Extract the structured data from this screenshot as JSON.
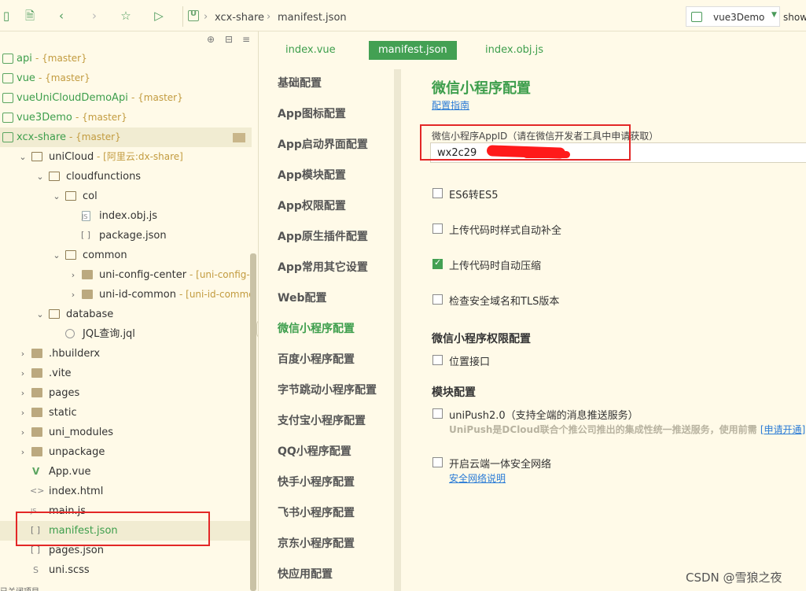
{
  "toolbar": {
    "breadcrumb": [
      "xcx-share",
      "manifest.json"
    ],
    "run_target": "vue3Demo",
    "show_label": "show"
  },
  "tree": {
    "rows": [
      {
        "name": "api",
        "branch": "- {master}",
        "kind": "project"
      },
      {
        "name": "vue",
        "branch": "- {master}",
        "kind": "project"
      },
      {
        "name": "vueUniCloudDemoApi",
        "branch": "- {master}",
        "kind": "project"
      },
      {
        "name": "vue3Demo",
        "branch": "- {master}",
        "kind": "project"
      },
      {
        "name": "xcx-share",
        "branch": "- {master}",
        "kind": "project"
      },
      {
        "name": "uniCloud",
        "branch": "- [阿里云:dx-share]",
        "kind": "folder"
      },
      {
        "name": "cloudfunctions",
        "branch": "",
        "kind": "folder"
      },
      {
        "name": "col",
        "branch": "",
        "kind": "folder"
      },
      {
        "name": "index.obj.js",
        "branch": "",
        "kind": "file"
      },
      {
        "name": "package.json",
        "branch": "",
        "kind": "file"
      },
      {
        "name": "common",
        "branch": "",
        "kind": "folder"
      },
      {
        "name": "uni-config-center",
        "branch": "- [uni-config-center",
        "kind": "folder"
      },
      {
        "name": "uni-id-common",
        "branch": "- [uni-id-common:un",
        "kind": "folder"
      },
      {
        "name": "database",
        "branch": "",
        "kind": "folder"
      },
      {
        "name": "JQL查询.jql",
        "branch": "",
        "kind": "file"
      },
      {
        "name": ".hbuilderx",
        "branch": "",
        "kind": "folder"
      },
      {
        "name": ".vite",
        "branch": "",
        "kind": "folder"
      },
      {
        "name": "pages",
        "branch": "",
        "kind": "folder"
      },
      {
        "name": "static",
        "branch": "",
        "kind": "folder"
      },
      {
        "name": "uni_modules",
        "branch": "",
        "kind": "folder"
      },
      {
        "name": "unpackage",
        "branch": "",
        "kind": "folder"
      },
      {
        "name": "App.vue",
        "branch": "",
        "kind": "file"
      },
      {
        "name": "index.html",
        "branch": "",
        "kind": "file"
      },
      {
        "name": "main.js",
        "branch": "",
        "kind": "file"
      },
      {
        "name": "manifest.json",
        "branch": "",
        "kind": "file"
      },
      {
        "name": "pages.json",
        "branch": "",
        "kind": "file"
      },
      {
        "name": "uni.scss",
        "branch": "",
        "kind": "file"
      }
    ],
    "status_fragment": "已关闭项目"
  },
  "tabs": [
    "index.vue",
    "manifest.json",
    "index.obj.js"
  ],
  "nav": [
    "基础配置",
    "App图标配置",
    "App启动界面配置",
    "App模块配置",
    "App权限配置",
    "App原生插件配置",
    "App常用其它设置",
    "Web配置",
    "微信小程序配置",
    "百度小程序配置",
    "字节跳动小程序配置",
    "支付宝小程序配置",
    "QQ小程序配置",
    "快手小程序配置",
    "飞书小程序配置",
    "京东小程序配置",
    "快应用配置"
  ],
  "panel": {
    "title": "微信小程序配置",
    "guide_link": "配置指南",
    "appid_label": "微信小程序AppID（请在微信开发者工具中申请获取）",
    "appid_value": "wx2c29",
    "options": [
      {
        "label": "ES6转ES5",
        "checked": false
      },
      {
        "label": "上传代码时样式自动补全",
        "checked": false
      },
      {
        "label": "上传代码时自动压缩",
        "checked": true
      },
      {
        "label": "检查安全域名和TLS版本",
        "checked": false
      }
    ],
    "perm_title": "微信小程序权限配置",
    "perm_option": "位置接口",
    "module_title": "模块配置",
    "unipush_label": "uniPush2.0（支持全端的消息推送服务）",
    "unipush_desc": "UniPush是DCloud联合个推公司推出的集成性统一推送服务，使用前需",
    "unipush_link": "[申请开通]",
    "secure_label": "开启云端一体安全网络",
    "secure_link": "安全网络说明"
  },
  "watermark": "CSDN @雪狼之夜"
}
